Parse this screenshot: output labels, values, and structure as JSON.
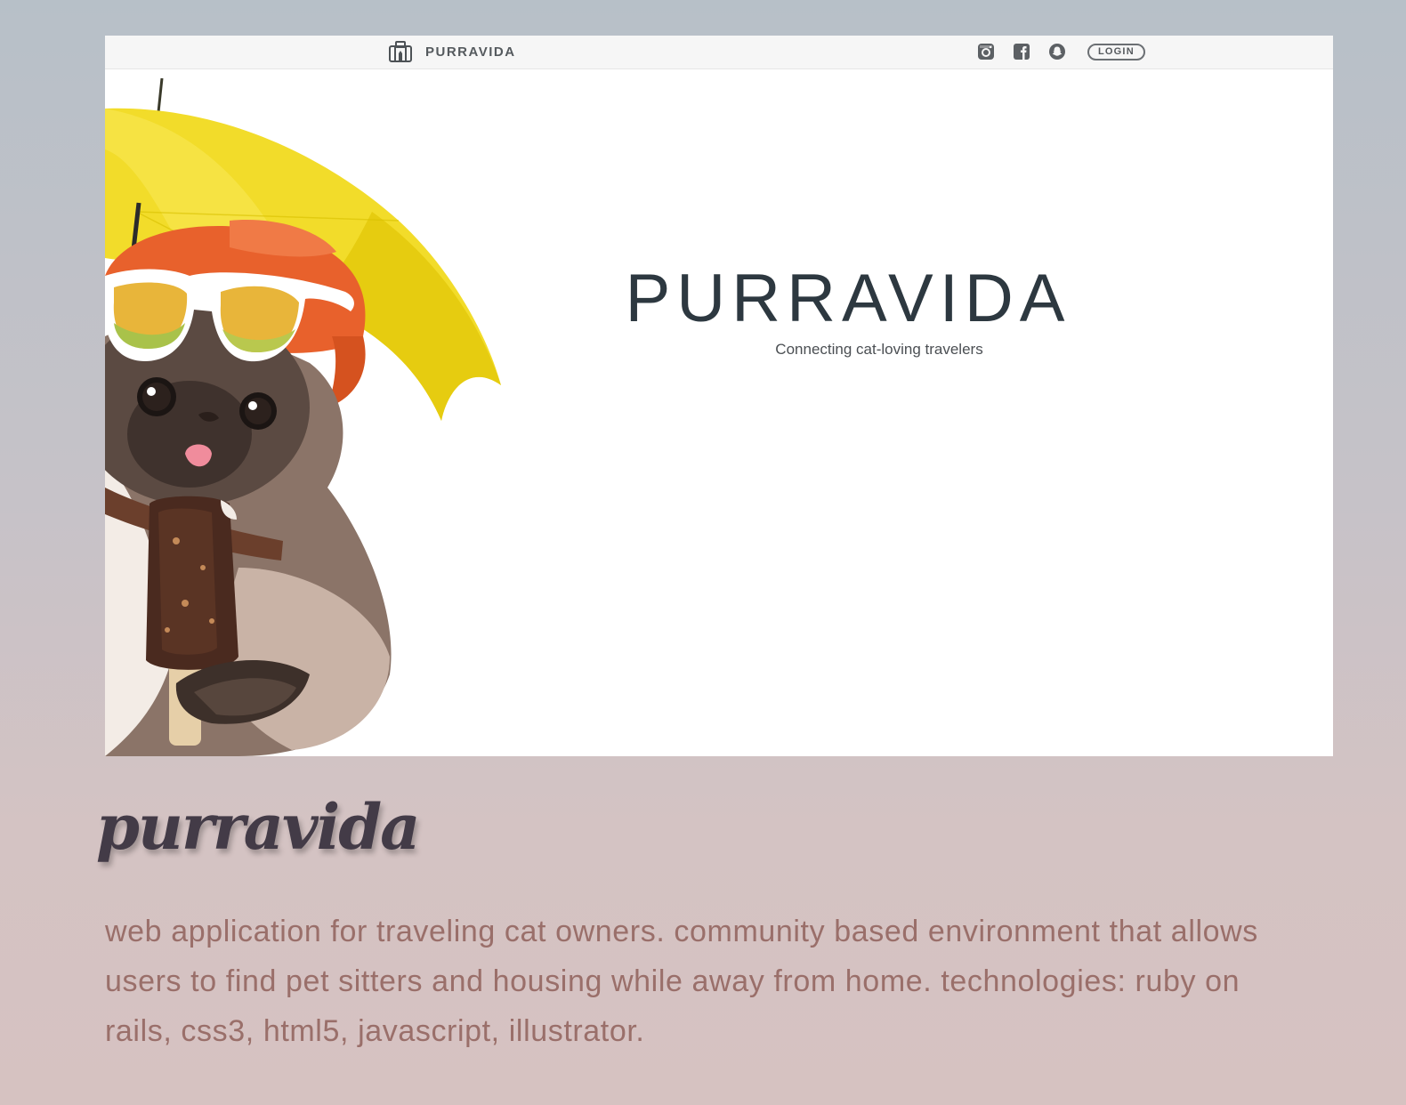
{
  "navbar": {
    "brand_name": "PURRAVIDA",
    "icons": [
      "instagram-icon",
      "facebook-icon",
      "snapchat-icon"
    ],
    "login_label": "LOGIN"
  },
  "hero": {
    "title": "PURRAVIDA",
    "tagline": "Connecting cat-loving travelers"
  },
  "project": {
    "title": "purravida",
    "description": "web application for traveling cat owners. community based environment that allows users to find pet sitters and housing while away from home. technologies: ruby on rails, css3, html5, javascript, illustrator."
  },
  "colors": {
    "background_top": "#b7c0c8",
    "background_bottom": "#d6c2c1",
    "hero_title": "#2d3840",
    "project_title": "#433b47",
    "project_description": "#9a6f6a",
    "umbrella": "#f2dc2a",
    "hat": "#e8612c"
  }
}
